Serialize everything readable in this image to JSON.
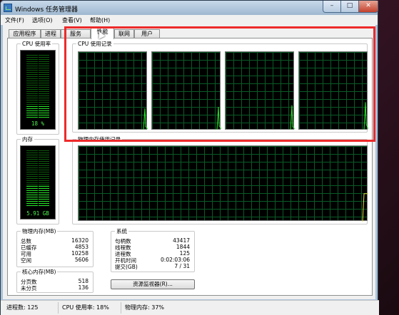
{
  "window": {
    "title": "Windows 任务管理器"
  },
  "titlebar_buttons": {
    "minimize": "–",
    "maximize": "□",
    "close": "✕"
  },
  "menu": [
    "文件(F)",
    "选项(O)",
    "查看(V)",
    "帮助(H)"
  ],
  "tabs": [
    {
      "label": "应用程序",
      "active": false
    },
    {
      "label": "进程",
      "active": false
    },
    {
      "label": "服务",
      "active": false
    },
    {
      "label": "性能",
      "active": true
    },
    {
      "label": "联网",
      "active": false
    },
    {
      "label": "用户",
      "active": false
    }
  ],
  "cpu_usage": {
    "label": "CPU 使用率",
    "value_text": "18 %",
    "level": 0.18
  },
  "cpu_history": {
    "label": "CPU 使用记录",
    "cores": [
      {
        "spike": 0.28,
        "tail": 0.05
      },
      {
        "spike": 0.3,
        "tail": 0.06
      },
      {
        "spike": 0.32,
        "tail": 0.05
      },
      {
        "spike": 0.36,
        "tail": 0.08
      }
    ]
  },
  "memory": {
    "label": "内存",
    "value_text": "5.91 GB",
    "level": 0.37
  },
  "memory_history": {
    "label": "物理内存使用记录",
    "level": 0.37
  },
  "physical_memory": {
    "label": "物理内存(MB)",
    "rows": [
      {
        "key": "总数",
        "value": "16320"
      },
      {
        "key": "已缓存",
        "value": "4853"
      },
      {
        "key": "可用",
        "value": "10258"
      },
      {
        "key": "空闲",
        "value": "5606"
      }
    ]
  },
  "kernel_memory": {
    "label": "核心内存(MB)",
    "rows": [
      {
        "key": "分页数",
        "value": "518"
      },
      {
        "key": "未分页",
        "value": "136"
      }
    ]
  },
  "system": {
    "label": "系统",
    "rows": [
      {
        "key": "句柄数",
        "value": "43417"
      },
      {
        "key": "线程数",
        "value": "1844"
      },
      {
        "key": "进程数",
        "value": "125"
      },
      {
        "key": "开机时间",
        "value": "0:02:03:06"
      },
      {
        "key": "提交(GB)",
        "value": "7 / 31"
      }
    ]
  },
  "resource_monitor_button": "资源监视器(R)...",
  "statusbar": {
    "processes": "进程数: 125",
    "cpu": "CPU 使用率: 18%",
    "memory": "物理内存: 37%"
  },
  "colors": {
    "graph_line": "#27e827",
    "grid": "#0a5b27",
    "highlight": "#ee2a2a"
  }
}
